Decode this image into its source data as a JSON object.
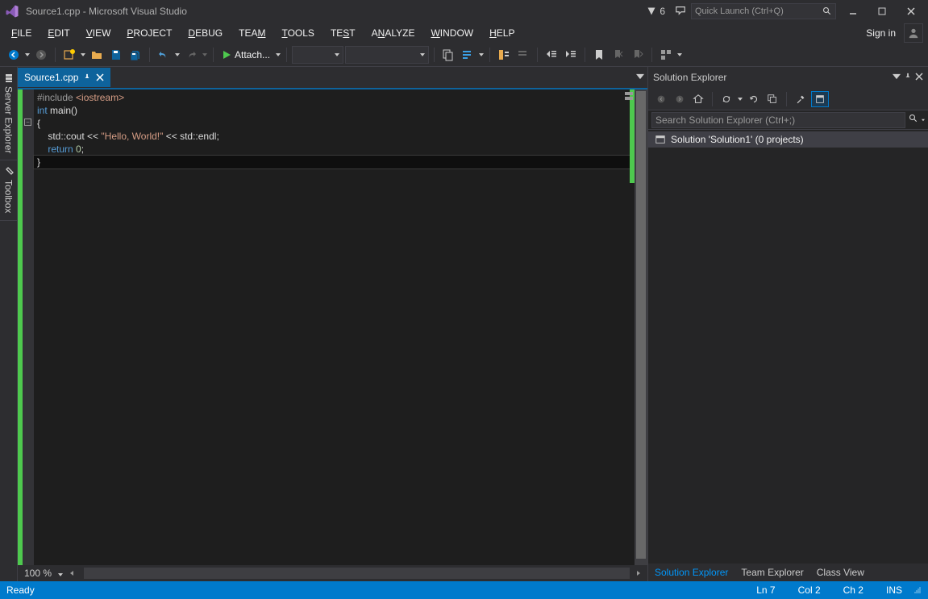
{
  "title": "Source1.cpp - Microsoft Visual Studio",
  "notifications_count": "6",
  "quick_launch_placeholder": "Quick Launch (Ctrl+Q)",
  "sign_in": "Sign in",
  "menu": {
    "file": "FILE",
    "edit": "EDIT",
    "view": "VIEW",
    "project": "PROJECT",
    "debug": "DEBUG",
    "team": "TEAM",
    "tools": "TOOLS",
    "test": "TEST",
    "analyze": "ANALYZE",
    "window": "WINDOW",
    "help": "HELP"
  },
  "toolbar": {
    "attach_label": "Attach..."
  },
  "side_tabs": {
    "server_explorer": "Server Explorer",
    "toolbox": "Toolbox"
  },
  "tab": {
    "name": "Source1.cpp"
  },
  "code": {
    "l1_a": "#include ",
    "l1_b": "<iostream>",
    "l2": "",
    "l3_a": "int",
    "l3_b": " main()",
    "l4": "{",
    "l5_a": "    std::cout << ",
    "l5_b": "\"Hello, World!\"",
    "l5_c": " << std::endl;",
    "l6_a": "    ",
    "l6_b": "return",
    "l6_c": " ",
    "l6_d": "0",
    "l6_e": ";",
    "l7": "}"
  },
  "zoom": "100 %",
  "solution_explorer": {
    "title": "Solution Explorer",
    "search_placeholder": "Search Solution Explorer (Ctrl+;)",
    "root": "Solution 'Solution1' (0 projects)",
    "tabs": {
      "se": "Solution Explorer",
      "te": "Team Explorer",
      "cv": "Class View"
    }
  },
  "status": {
    "ready": "Ready",
    "ln": "Ln 7",
    "col": "Col 2",
    "ch": "Ch 2",
    "ins": "INS"
  }
}
